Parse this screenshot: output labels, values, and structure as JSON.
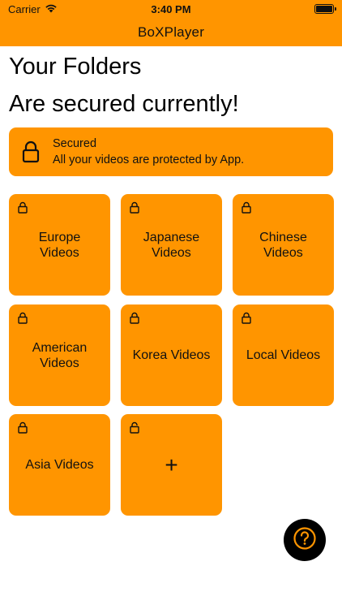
{
  "status_bar": {
    "carrier": "Carrier",
    "time": "3:40 PM"
  },
  "nav": {
    "title": "BoXPlayer"
  },
  "headings": {
    "line1": "Your Folders",
    "line2": "Are secured currently!"
  },
  "banner": {
    "title": "Secured",
    "subtitle": "All your videos are protected by App.",
    "icon": "lock-icon"
  },
  "folders": [
    {
      "label": "Europe\nVideos",
      "locked": true
    },
    {
      "label": "Japanese\nVideos",
      "locked": true
    },
    {
      "label": "Chinese\nVideos",
      "locked": true
    },
    {
      "label": "American\nVideos",
      "locked": true
    },
    {
      "label": "Korea Videos",
      "locked": true
    },
    {
      "label": "Local Videos",
      "locked": true
    },
    {
      "label": "Asia Videos",
      "locked": true
    }
  ],
  "add_tile": {
    "label": "+",
    "locked": false
  },
  "help_button": {
    "icon": "question-mark-icon",
    "label": "?"
  },
  "colors": {
    "accent": "#FF9500",
    "help_bg": "#000000",
    "help_fg": "#FF9500"
  }
}
